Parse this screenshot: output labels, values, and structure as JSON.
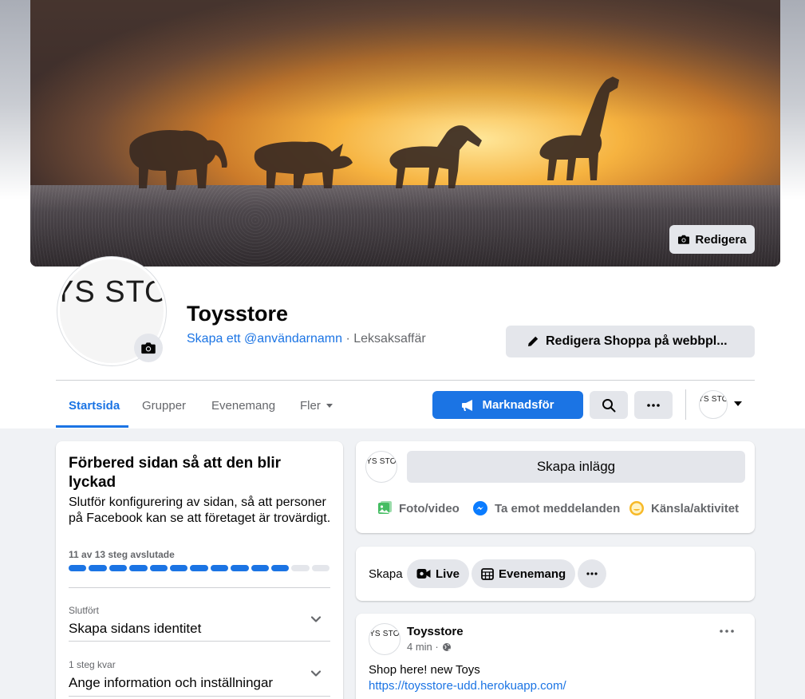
{
  "cover": {
    "edit_label": "Redigera"
  },
  "page": {
    "avatar_logo_text": "YS STOR",
    "name": "Toysstore",
    "username_link": "Skapa ett @användarnamn",
    "category": "· Leksaksaffär",
    "shop_button_label": "Redigera Shoppa på webbpl..."
  },
  "tabs": [
    {
      "label": "Startsida",
      "active": true
    },
    {
      "label": "Grupper"
    },
    {
      "label": "Evenemang"
    },
    {
      "label": "Fler"
    }
  ],
  "actions": {
    "promote_label": "Marknadsför",
    "account_logo_text": "YS STOR"
  },
  "setup_card": {
    "title": "Förbered sidan så att den blir lyckad",
    "description": "Slutför konfigurering av sidan, så att personer på Facebook kan se att företaget är trovärdigt.",
    "progress_label": "11 av 13 steg avslutade",
    "steps_done": 11,
    "steps_total": 13,
    "steps": [
      {
        "status": "Slutfört",
        "title": "Skapa sidans identitet"
      },
      {
        "status": "1 steg kvar",
        "title": "Ange information och inställningar"
      }
    ]
  },
  "composer": {
    "logo_text": "YS STOR",
    "create_post_label": "Skapa inlägg",
    "actions": [
      {
        "icon": "photo-video-icon",
        "label": "Foto/video",
        "color": "#45bd62"
      },
      {
        "icon": "messenger-icon",
        "label": "Ta emot meddelanden",
        "color": "#0a7cff"
      },
      {
        "icon": "feeling-icon",
        "label": "Känsla/aktivitet",
        "color": "#f7b928"
      }
    ]
  },
  "create_bar": {
    "label": "Skapa",
    "live_label": "Live",
    "event_label": "Evenemang"
  },
  "post": {
    "logo_text": "YS STOR",
    "author": "Toysstore",
    "time": "4 min ·",
    "text": "Shop here! new Toys",
    "link": "https://toysstore-udd.herokuapp.com/"
  },
  "colors": {
    "brand_blue": "#1b74e4",
    "button_grey": "#e4e6eb",
    "feed_background": "#f0f2f5"
  }
}
